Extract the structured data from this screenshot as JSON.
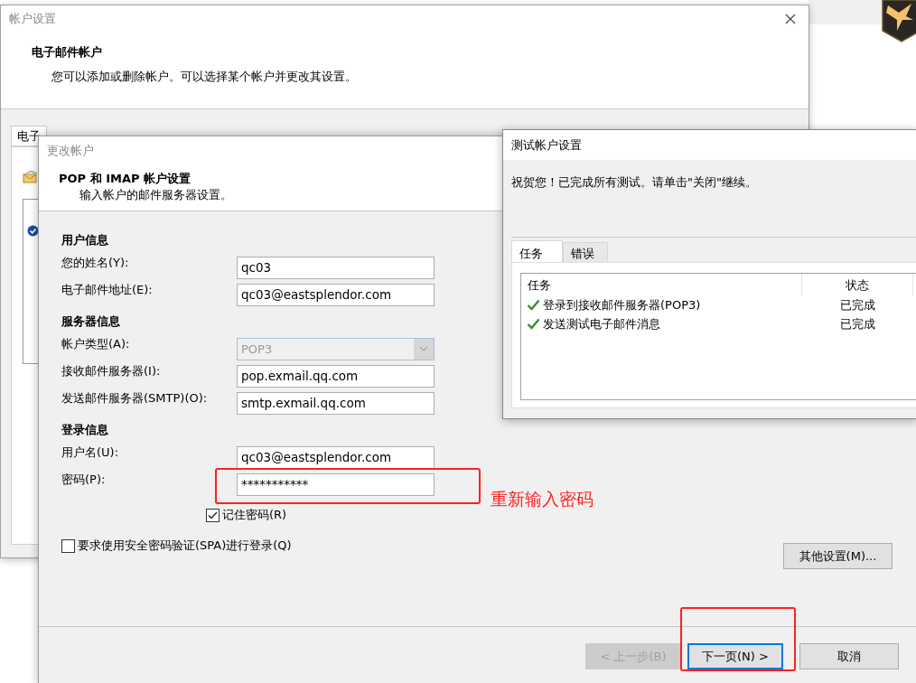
{
  "account_settings_window": {
    "title": "帐户设置",
    "heading": "电子邮件帐户",
    "description": "您可以添加或删除帐户。可以选择某个帐户并更改其设置。",
    "tabs": [
      {
        "label": "电子",
        "selected": true
      }
    ]
  },
  "change_account_dialog": {
    "title": "更改帐户",
    "heading": "POP 和 IMAP 帐户设置",
    "description": "输入帐户的邮件服务器设置。",
    "sections": [
      {
        "title": "用户信息",
        "fields": [
          {
            "kind": "text",
            "label": "您的姓名(Y):",
            "value": "qc03"
          },
          {
            "kind": "text",
            "label": "电子邮件地址(E):",
            "value": "qc03@eastsplendor.com"
          }
        ]
      },
      {
        "title": "服务器信息",
        "fields": [
          {
            "kind": "dropdown",
            "label": "帐户类型(A):",
            "value": "POP3",
            "disabled": true
          },
          {
            "kind": "text",
            "label": "接收邮件服务器(I):",
            "value": "pop.exmail.qq.com"
          },
          {
            "kind": "text",
            "label": "发送邮件服务器(SMTP)(O):",
            "value": "smtp.exmail.qq.com"
          }
        ]
      },
      {
        "title": "登录信息",
        "fields": [
          {
            "kind": "text",
            "label": "用户名(U):",
            "value": "qc03@eastsplendor.com"
          },
          {
            "kind": "password",
            "label": "密码(P):",
            "value": "***********"
          }
        ]
      }
    ],
    "remember_password": {
      "label": "记住密码(R)",
      "checked": true
    },
    "require_spa": {
      "label": "要求使用安全密码验证(SPA)进行登录(Q)",
      "checked": false
    },
    "more_settings_button": "其他设置(M)...",
    "buttons": [
      {
        "label": "< 上一步(B)",
        "disabled": true,
        "focused": false
      },
      {
        "label": "下一页(N) >",
        "disabled": false,
        "focused": true
      },
      {
        "label": "取消",
        "disabled": false,
        "focused": false
      }
    ]
  },
  "test_account_dialog": {
    "title": "测试帐户设置",
    "message": "祝贺您！已完成所有测试。请单击\"关闭\"继续。",
    "tabs": [
      {
        "label": "任务",
        "selected": true
      },
      {
        "label": "错误",
        "selected": false
      }
    ],
    "columns": [
      "任务",
      "状态"
    ],
    "rows": [
      {
        "task": "登录到接收邮件服务器(POP3)",
        "status": "已完成",
        "completed": true
      },
      {
        "task": "发送测试电子邮件消息",
        "status": "已完成",
        "completed": true
      }
    ]
  },
  "annotations": [
    {
      "kind": "box"
    },
    {
      "kind": "note",
      "text": "重新输入密码"
    },
    {
      "kind": "box"
    }
  ]
}
